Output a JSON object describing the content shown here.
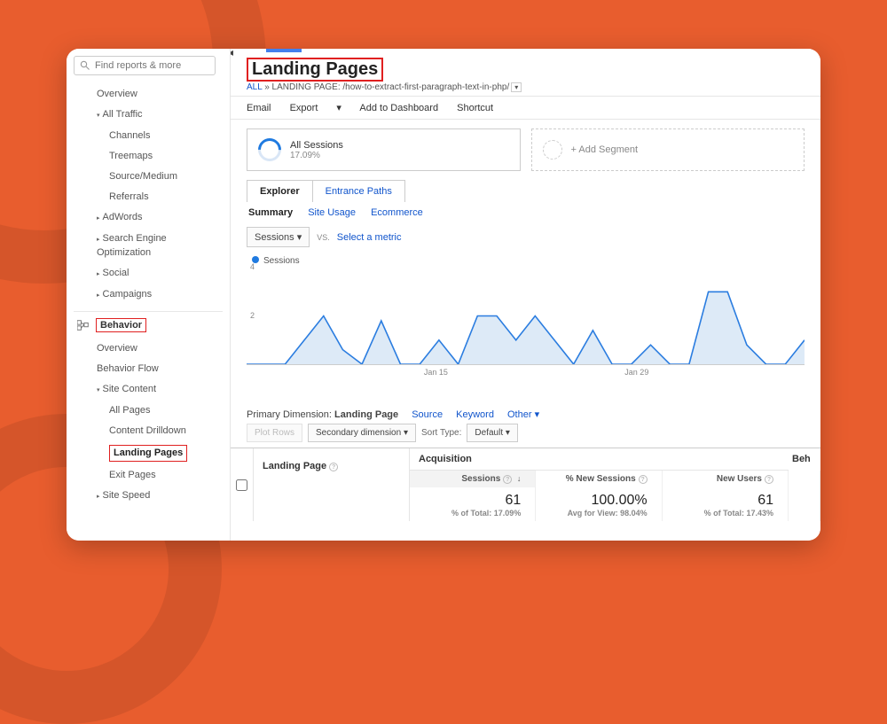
{
  "search": {
    "placeholder": "Find reports & more"
  },
  "nav": {
    "overview1": "Overview",
    "alltraffic": "All Traffic",
    "channels": "Channels",
    "treemaps": "Treemaps",
    "sourcemedium": "Source/Medium",
    "referrals": "Referrals",
    "adwords": "AdWords",
    "seo": "Search Engine Optimization",
    "social": "Social",
    "campaigns": "Campaigns",
    "behavior": "Behavior",
    "overview2": "Overview",
    "behaviorflow": "Behavior Flow",
    "sitecontent": "Site Content",
    "allpages": "All Pages",
    "contentdrill": "Content Drilldown",
    "landingpages": "Landing Pages",
    "exitpages": "Exit Pages",
    "sitespeed": "Site Speed"
  },
  "header": {
    "title": "Landing Pages",
    "bc_all": "ALL",
    "bc_sep": " » LANDING PAGE: ",
    "bc_page": "/how-to-extract-first-paragraph-text-in-php/"
  },
  "toolbar": {
    "email": "Email",
    "export": "Export",
    "add": "Add to Dashboard",
    "shortcut": "Shortcut"
  },
  "segment": {
    "allsessions": "All Sessions",
    "pct": "17.09%",
    "add": "+ Add Segment"
  },
  "tabs": {
    "explorer": "Explorer",
    "entrance": "Entrance Paths"
  },
  "sublinks": {
    "summary": "Summary",
    "siteusage": "Site Usage",
    "ecommerce": "Ecommerce"
  },
  "selector": {
    "sessions": "Sessions",
    "vs": "VS.",
    "select": "Select a metric"
  },
  "chart_legend": "Sessions",
  "chart_data": {
    "type": "line",
    "series_name": "Sessions",
    "x_labels": [
      "Jan 15",
      "Jan 29"
    ],
    "x_label_positions": [
      0.34,
      0.7
    ],
    "ylim": [
      0,
      4
    ],
    "yticks": [
      2,
      4
    ],
    "values": [
      0,
      0,
      0,
      1,
      2,
      0.6,
      0,
      1.8,
      0,
      0,
      1,
      0,
      2,
      2,
      1,
      2,
      1,
      0,
      1.4,
      0,
      0,
      0.8,
      0,
      0,
      3,
      3,
      0.8,
      0,
      0,
      1
    ]
  },
  "dimension": {
    "label": "Primary Dimension:",
    "landing": "Landing Page",
    "source": "Source",
    "keyword": "Keyword",
    "other": "Other"
  },
  "controls": {
    "plot": "Plot Rows",
    "secondary": "Secondary dimension",
    "sort": "Sort Type:",
    "default": "Default"
  },
  "table": {
    "lp_header": "Landing Page",
    "acq_header": "Acquisition",
    "beh_header": "Beh",
    "cols": {
      "sessions": "Sessions",
      "newsess": "% New Sessions",
      "newusers": "New Users"
    },
    "row": {
      "sessions_v": "61",
      "sessions_s": "% of Total: 17.09%",
      "newsess_v": "100.00%",
      "newsess_s": "Avg for View: 98.04%",
      "newusers_v": "61",
      "newusers_s": "% of Total: 17.43%"
    }
  }
}
